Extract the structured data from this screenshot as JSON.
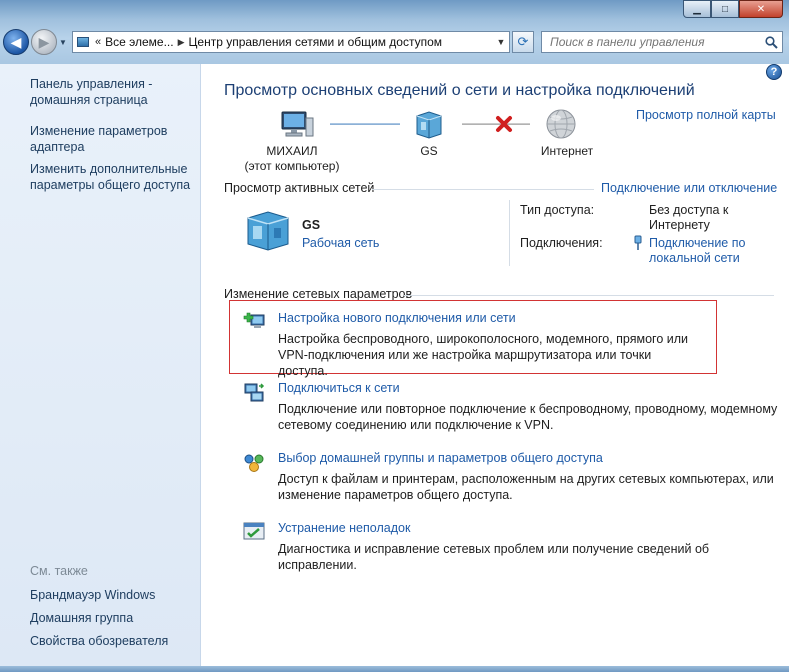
{
  "window": {
    "minimize": "▁",
    "maximize": "□",
    "close": "✕"
  },
  "address": {
    "chevron": "«",
    "segments": [
      "Все элеме...",
      "Центр управления сетями и общим доступом"
    ]
  },
  "search": {
    "placeholder": "Поиск в панели управления"
  },
  "sidebar": {
    "links": [
      "Панель управления - домашняя страница",
      "Изменение параметров адаптера",
      "Изменить дополнительные параметры общего доступа"
    ],
    "see_also_header": "См. также",
    "see_also": [
      "Брандмауэр Windows",
      "Домашняя группа",
      "Свойства обозревателя"
    ]
  },
  "main": {
    "title": "Просмотр основных сведений о сети и настройка подключений",
    "full_map_link": "Просмотр полной карты",
    "map": {
      "computer_name": "МИХАИЛ",
      "computer_sub": "(этот компьютер)",
      "network_name": "GS",
      "internet": "Интернет"
    },
    "active": {
      "title": "Просмотр активных сетей",
      "connect_link": "Подключение или отключение",
      "network_name": "GS",
      "network_type": "Рабочая сеть",
      "access_label": "Тип доступа:",
      "access_value": "Без доступа к Интернету",
      "connections_label": "Подключения:",
      "connections_value": "Подключение по локальной сети"
    },
    "change": {
      "title": "Изменение сетевых параметров",
      "tasks": [
        {
          "title": "Настройка нового подключения или сети",
          "desc": "Настройка беспроводного, широкополосного, модемного, прямого или VPN-подключения или же настройка маршрутизатора или точки доступа."
        },
        {
          "title": "Подключиться к сети",
          "desc": "Подключение или повторное подключение к беспроводному, проводному, модемному сетевому соединению или подключение к VPN."
        },
        {
          "title": "Выбор домашней группы и параметров общего доступа",
          "desc": "Доступ к файлам и принтерам, расположенным на других сетевых компьютерах, или изменение параметров общего доступа."
        },
        {
          "title": "Устранение неполадок",
          "desc": "Диагностика и исправление сетевых проблем или получение сведений об исправлении."
        }
      ]
    }
  },
  "colors": {
    "link": "#1f5ba8",
    "title": "#1c3f74",
    "highlight_border": "#d23434",
    "sidebar_bg": "#e3edf8"
  }
}
